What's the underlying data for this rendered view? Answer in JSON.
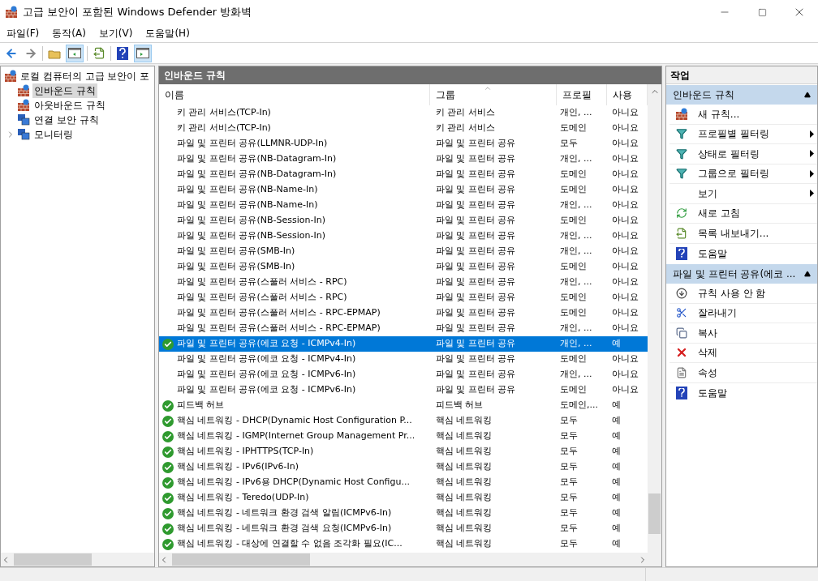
{
  "window": {
    "title": "고급 보안이 포함된 Windows Defender 방화벽"
  },
  "menu": [
    "파일(F)",
    "동작(A)",
    "보기(V)",
    "도움말(H)"
  ],
  "tree": {
    "root": "로컬 컴퓨터의 고급 보안이 포",
    "items": [
      {
        "label": "인바운드 규칙",
        "selected": true,
        "expandable": false
      },
      {
        "label": "아웃바운드 규칙",
        "selected": false,
        "expandable": false
      },
      {
        "label": "연결 보안 규칙",
        "selected": false,
        "expandable": false
      },
      {
        "label": "모니터링",
        "selected": false,
        "expandable": true
      }
    ]
  },
  "center": {
    "title": "인바운드 규칙",
    "columns": [
      "이름",
      "그룹",
      "프로필",
      "사용"
    ],
    "rows": [
      {
        "name": "키 관리 서비스(TCP-In)",
        "group": "키 관리 서비스",
        "profile": "개인, ...",
        "enabled": "아니요",
        "allowed": false,
        "selected": false
      },
      {
        "name": "키 관리 서비스(TCP-In)",
        "group": "키 관리 서비스",
        "profile": "도메인",
        "enabled": "아니요",
        "allowed": false,
        "selected": false
      },
      {
        "name": "파일 및 프린터 공유(LLMNR-UDP-In)",
        "group": "파일 및 프린터 공유",
        "profile": "모두",
        "enabled": "아니요",
        "allowed": false,
        "selected": false
      },
      {
        "name": "파일 및 프린터 공유(NB-Datagram-In)",
        "group": "파일 및 프린터 공유",
        "profile": "개인, ...",
        "enabled": "아니요",
        "allowed": false,
        "selected": false
      },
      {
        "name": "파일 및 프린터 공유(NB-Datagram-In)",
        "group": "파일 및 프린터 공유",
        "profile": "도메인",
        "enabled": "아니요",
        "allowed": false,
        "selected": false
      },
      {
        "name": "파일 및 프린터 공유(NB-Name-In)",
        "group": "파일 및 프린터 공유",
        "profile": "도메인",
        "enabled": "아니요",
        "allowed": false,
        "selected": false
      },
      {
        "name": "파일 및 프린터 공유(NB-Name-In)",
        "group": "파일 및 프린터 공유",
        "profile": "개인, ...",
        "enabled": "아니요",
        "allowed": false,
        "selected": false
      },
      {
        "name": "파일 및 프린터 공유(NB-Session-In)",
        "group": "파일 및 프린터 공유",
        "profile": "도메인",
        "enabled": "아니요",
        "allowed": false,
        "selected": false
      },
      {
        "name": "파일 및 프린터 공유(NB-Session-In)",
        "group": "파일 및 프린터 공유",
        "profile": "개인, ...",
        "enabled": "아니요",
        "allowed": false,
        "selected": false
      },
      {
        "name": "파일 및 프린터 공유(SMB-In)",
        "group": "파일 및 프린터 공유",
        "profile": "개인, ...",
        "enabled": "아니요",
        "allowed": false,
        "selected": false
      },
      {
        "name": "파일 및 프린터 공유(SMB-In)",
        "group": "파일 및 프린터 공유",
        "profile": "도메인",
        "enabled": "아니요",
        "allowed": false,
        "selected": false
      },
      {
        "name": "파일 및 프린터 공유(스풀러 서비스 - RPC)",
        "group": "파일 및 프린터 공유",
        "profile": "개인, ...",
        "enabled": "아니요",
        "allowed": false,
        "selected": false
      },
      {
        "name": "파일 및 프린터 공유(스풀러 서비스 - RPC)",
        "group": "파일 및 프린터 공유",
        "profile": "도메인",
        "enabled": "아니요",
        "allowed": false,
        "selected": false
      },
      {
        "name": "파일 및 프린터 공유(스풀러 서비스 - RPC-EPMAP)",
        "group": "파일 및 프린터 공유",
        "profile": "도메인",
        "enabled": "아니요",
        "allowed": false,
        "selected": false
      },
      {
        "name": "파일 및 프린터 공유(스풀러 서비스 - RPC-EPMAP)",
        "group": "파일 및 프린터 공유",
        "profile": "개인, ...",
        "enabled": "아니요",
        "allowed": false,
        "selected": false
      },
      {
        "name": "파일 및 프린터 공유(에코 요청 - ICMPv4-In)",
        "group": "파일 및 프린터 공유",
        "profile": "개인, ...",
        "enabled": "예",
        "allowed": true,
        "selected": true
      },
      {
        "name": "파일 및 프린터 공유(에코 요청 - ICMPv4-In)",
        "group": "파일 및 프린터 공유",
        "profile": "도메인",
        "enabled": "아니요",
        "allowed": false,
        "selected": false
      },
      {
        "name": "파일 및 프린터 공유(에코 요청 - ICMPv6-In)",
        "group": "파일 및 프린터 공유",
        "profile": "개인, ...",
        "enabled": "아니요",
        "allowed": false,
        "selected": false
      },
      {
        "name": "파일 및 프린터 공유(에코 요청 - ICMPv6-In)",
        "group": "파일 및 프린터 공유",
        "profile": "도메인",
        "enabled": "아니요",
        "allowed": false,
        "selected": false
      },
      {
        "name": "피드백 허브",
        "group": "피드백 허브",
        "profile": "도메인,...",
        "enabled": "예",
        "allowed": true,
        "selected": false
      },
      {
        "name": "핵심 네트워킹 - DHCP(Dynamic Host Configuration P...",
        "group": "핵심 네트워킹",
        "profile": "모두",
        "enabled": "예",
        "allowed": true,
        "selected": false
      },
      {
        "name": "핵심 네트워킹 - IGMP(Internet Group Management Pr...",
        "group": "핵심 네트워킹",
        "profile": "모두",
        "enabled": "예",
        "allowed": true,
        "selected": false
      },
      {
        "name": "핵심 네트워킹 - IPHTTPS(TCP-In)",
        "group": "핵심 네트워킹",
        "profile": "모두",
        "enabled": "예",
        "allowed": true,
        "selected": false
      },
      {
        "name": "핵심 네트워킹 - IPv6(IPv6-In)",
        "group": "핵심 네트워킹",
        "profile": "모두",
        "enabled": "예",
        "allowed": true,
        "selected": false
      },
      {
        "name": "핵심 네트워킹 - IPv6용 DHCP(Dynamic Host Configu...",
        "group": "핵심 네트워킹",
        "profile": "모두",
        "enabled": "예",
        "allowed": true,
        "selected": false
      },
      {
        "name": "핵심 네트워킹 - Teredo(UDP-In)",
        "group": "핵심 네트워킹",
        "profile": "모두",
        "enabled": "예",
        "allowed": true,
        "selected": false
      },
      {
        "name": "핵심 네트워킹 - 네트워크 환경 검색 알림(ICMPv6-In)",
        "group": "핵심 네트워킹",
        "profile": "모두",
        "enabled": "예",
        "allowed": true,
        "selected": false
      },
      {
        "name": "핵심 네트워킹 - 네트워크 환경 검색 요청(ICMPv6-In)",
        "group": "핵심 네트워킹",
        "profile": "모두",
        "enabled": "예",
        "allowed": true,
        "selected": false
      },
      {
        "name": "핵심 네트워킹 - 대상에 연결할 수 없음 조각화 필요(IC...",
        "group": "핵심 네트워킹",
        "profile": "모두",
        "enabled": "예",
        "allowed": true,
        "selected": false
      }
    ]
  },
  "actions": {
    "title": "작업",
    "sections": [
      {
        "title": "인바운드 규칙",
        "expanded": true,
        "items": [
          {
            "label": "새 규칙...",
            "has_submenu": false
          },
          {
            "label": "프로필별 필터링",
            "has_submenu": true
          },
          {
            "label": "상태로 필터링",
            "has_submenu": true
          },
          {
            "label": "그룹으로 필터링",
            "has_submenu": true
          },
          {
            "label": "보기",
            "has_submenu": true
          },
          {
            "label": "새로 고침",
            "has_submenu": false
          },
          {
            "label": "목록 내보내기...",
            "has_submenu": false
          },
          {
            "label": "도움말",
            "has_submenu": false
          }
        ]
      },
      {
        "title": "파일 및 프린터 공유(에코 ...",
        "expanded": true,
        "items": [
          {
            "label": "규칙 사용 안 함",
            "has_submenu": false
          },
          {
            "label": "잘라내기",
            "has_submenu": false
          },
          {
            "label": "복사",
            "has_submenu": false
          },
          {
            "label": "삭제",
            "has_submenu": false
          },
          {
            "label": "속성",
            "has_submenu": false
          },
          {
            "label": "도움말",
            "has_submenu": false
          }
        ]
      }
    ]
  }
}
